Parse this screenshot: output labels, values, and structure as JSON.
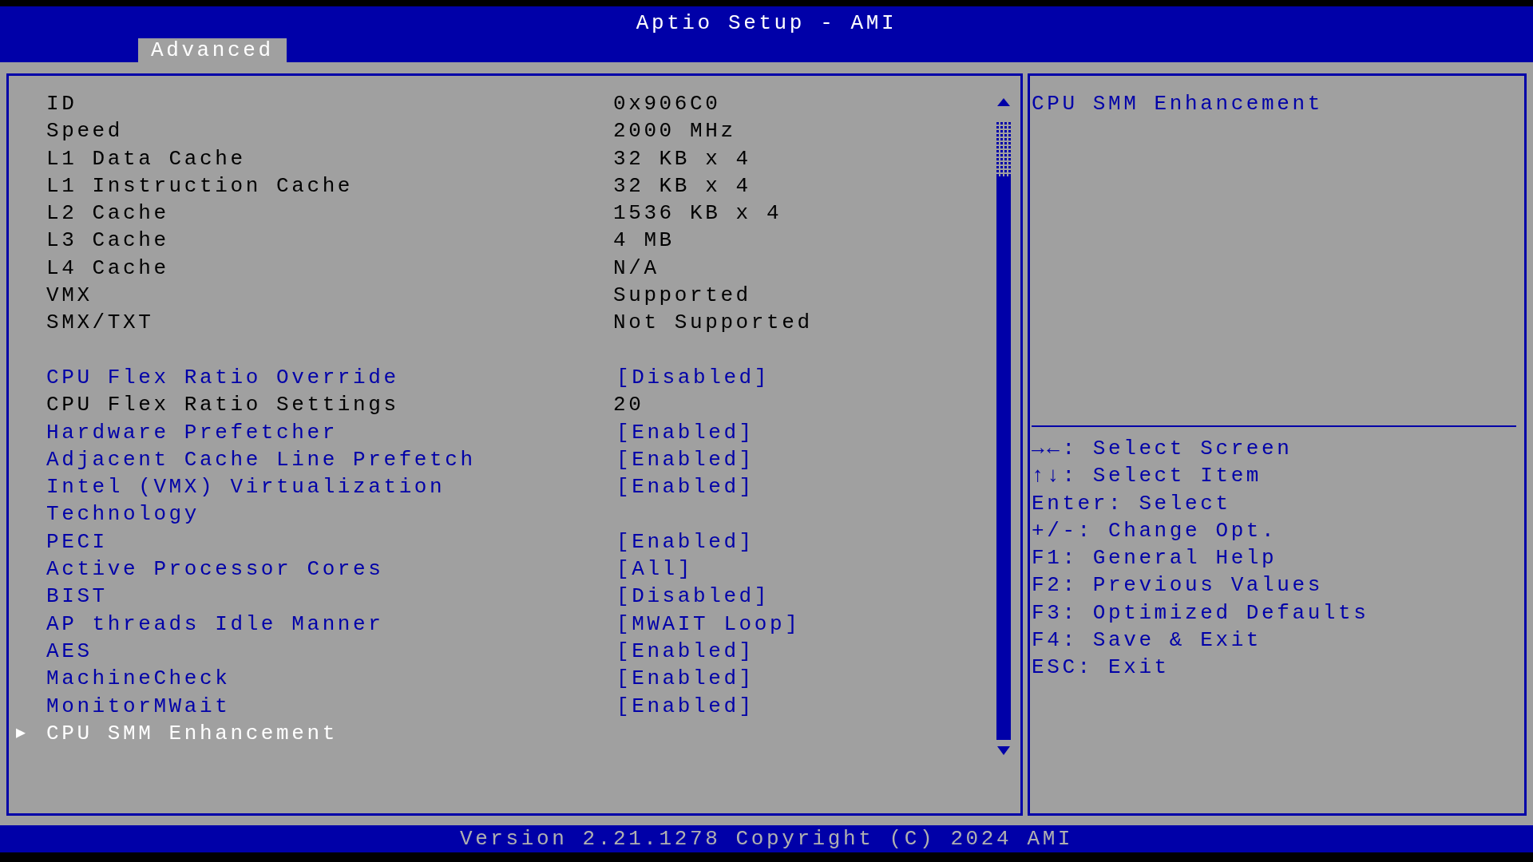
{
  "header": {
    "title": "Aptio Setup - AMI",
    "tabs": [
      {
        "label": "Advanced",
        "selected": true
      }
    ]
  },
  "items": [
    {
      "kind": "info",
      "label": "ID",
      "value": "0x906C0"
    },
    {
      "kind": "info",
      "label": "Speed",
      "value": "2000 MHz"
    },
    {
      "kind": "info",
      "label": "L1 Data Cache",
      "value": "32 KB x 4"
    },
    {
      "kind": "info",
      "label": "L1 Instruction Cache",
      "value": "32 KB x 4"
    },
    {
      "kind": "info",
      "label": "L2 Cache",
      "value": "1536 KB x 4"
    },
    {
      "kind": "info",
      "label": "L3 Cache",
      "value": "4 MB"
    },
    {
      "kind": "info",
      "label": "L4 Cache",
      "value": "N/A"
    },
    {
      "kind": "info",
      "label": "VMX",
      "value": "Supported"
    },
    {
      "kind": "info",
      "label": "SMX/TXT",
      "value": "Not Supported"
    },
    {
      "kind": "blank"
    },
    {
      "kind": "setting",
      "label": "CPU Flex Ratio Override",
      "value": "[Disabled]",
      "selected": false
    },
    {
      "kind": "info",
      "label": "CPU Flex Ratio Settings",
      "value": "20"
    },
    {
      "kind": "setting",
      "label": "Hardware Prefetcher",
      "value": "[Enabled]",
      "selected": false
    },
    {
      "kind": "setting",
      "label": "Adjacent Cache Line Prefetch",
      "value": "[Enabled]",
      "selected": false
    },
    {
      "kind": "setting",
      "label": "Intel (VMX) Virtualization Technology",
      "value": "[Enabled]",
      "selected": false
    },
    {
      "kind": "setting",
      "label": "PECI",
      "value": "[Enabled]",
      "selected": false
    },
    {
      "kind": "setting",
      "label": "Active Processor Cores",
      "value": "[All]",
      "selected": false
    },
    {
      "kind": "setting",
      "label": "BIST",
      "value": "[Disabled]",
      "selected": false
    },
    {
      "kind": "setting",
      "label": "AP threads Idle Manner",
      "value": "[MWAIT Loop]",
      "selected": false
    },
    {
      "kind": "setting",
      "label": "AES",
      "value": "[Enabled]",
      "selected": false
    },
    {
      "kind": "setting",
      "label": "MachineCheck",
      "value": "[Enabled]",
      "selected": false
    },
    {
      "kind": "setting",
      "label": "MonitorMWait",
      "value": "[Enabled]",
      "selected": false
    },
    {
      "kind": "submenu",
      "label": "CPU SMM Enhancement",
      "pointer": "▶",
      "selected": true
    }
  ],
  "help": {
    "description": "CPU SMM Enhancement",
    "keys": [
      "→←: Select Screen",
      "↑↓: Select Item",
      "Enter: Select",
      "+/-: Change Opt.",
      "F1: General Help",
      "F2: Previous Values",
      "F3: Optimized Defaults",
      "F4: Save & Exit",
      "ESC: Exit"
    ]
  },
  "footer": "Version 2.21.1278 Copyright (C) 2024 AMI"
}
